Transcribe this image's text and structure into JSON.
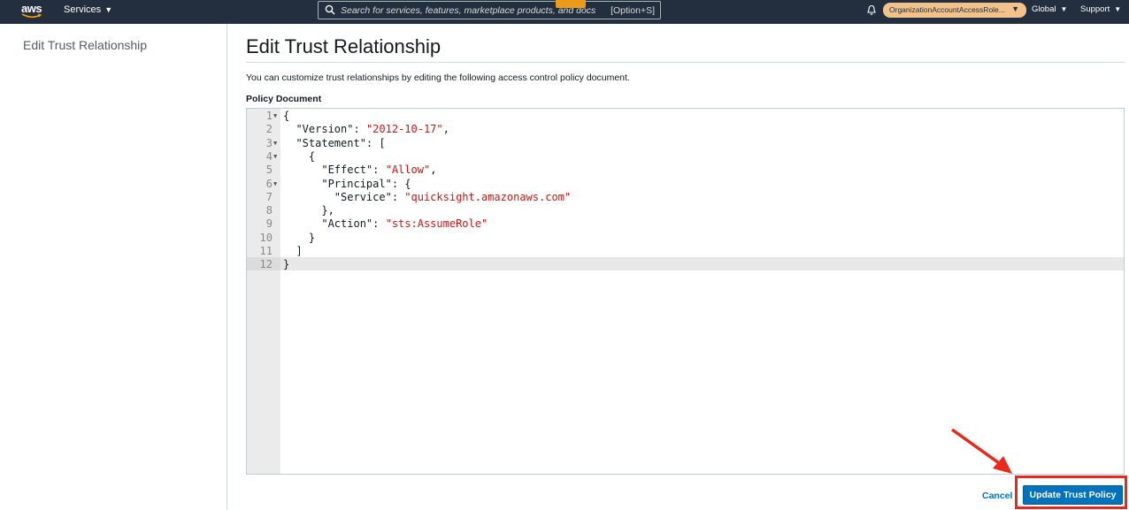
{
  "topnav": {
    "logo_text": "aws",
    "services_label": "Services",
    "search_placeholder": "Search for services, features, marketplace products, and docs",
    "search_shortcut": "[Option+S]",
    "account_label": "OrganizationAccountAccessRole...",
    "region_label": "Global",
    "support_label": "Support"
  },
  "sidebar": {
    "title": "Edit Trust Relationship"
  },
  "main": {
    "title": "Edit Trust Relationship",
    "description": "You can customize trust relationships by editing the following access control policy document.",
    "doc_label": "Policy Document"
  },
  "editor": {
    "lines": [
      {
        "n": "1",
        "fold": true,
        "indent": "",
        "parts": [
          [
            "p",
            "{"
          ]
        ]
      },
      {
        "n": "2",
        "fold": false,
        "indent": "  ",
        "parts": [
          [
            "p",
            "\"Version\": "
          ],
          [
            "s",
            "\"2012-10-17\""
          ],
          [
            "p",
            ","
          ]
        ]
      },
      {
        "n": "3",
        "fold": true,
        "indent": "  ",
        "parts": [
          [
            "p",
            "\"Statement\": ["
          ]
        ]
      },
      {
        "n": "4",
        "fold": true,
        "indent": "    ",
        "parts": [
          [
            "p",
            "{"
          ]
        ]
      },
      {
        "n": "5",
        "fold": false,
        "indent": "      ",
        "parts": [
          [
            "p",
            "\"Effect\": "
          ],
          [
            "s",
            "\"Allow\""
          ],
          [
            "p",
            ","
          ]
        ]
      },
      {
        "n": "6",
        "fold": true,
        "indent": "      ",
        "parts": [
          [
            "p",
            "\"Principal\": {"
          ]
        ]
      },
      {
        "n": "7",
        "fold": false,
        "indent": "        ",
        "parts": [
          [
            "p",
            "\"Service\": "
          ],
          [
            "s",
            "\"quicksight.amazonaws.com\""
          ]
        ]
      },
      {
        "n": "8",
        "fold": false,
        "indent": "      ",
        "parts": [
          [
            "p",
            "},"
          ]
        ]
      },
      {
        "n": "9",
        "fold": false,
        "indent": "      ",
        "parts": [
          [
            "p",
            "\"Action\": "
          ],
          [
            "s",
            "\"sts:AssumeRole\""
          ]
        ]
      },
      {
        "n": "10",
        "fold": false,
        "indent": "    ",
        "parts": [
          [
            "p",
            "}"
          ]
        ]
      },
      {
        "n": "11",
        "fold": false,
        "indent": "  ",
        "parts": [
          [
            "p",
            "]"
          ]
        ]
      },
      {
        "n": "12",
        "fold": false,
        "indent": "",
        "parts": [
          [
            "p",
            "}"
          ]
        ]
      }
    ],
    "active_line": "12"
  },
  "actions": {
    "cancel_label": "Cancel",
    "update_label": "Update Trust Policy"
  },
  "colors": {
    "nav_bg": "#232f3e",
    "string": "#c41a16",
    "primary": "#0073bb",
    "annotation": "#e8291c",
    "account_pill": "#f1c38a"
  }
}
